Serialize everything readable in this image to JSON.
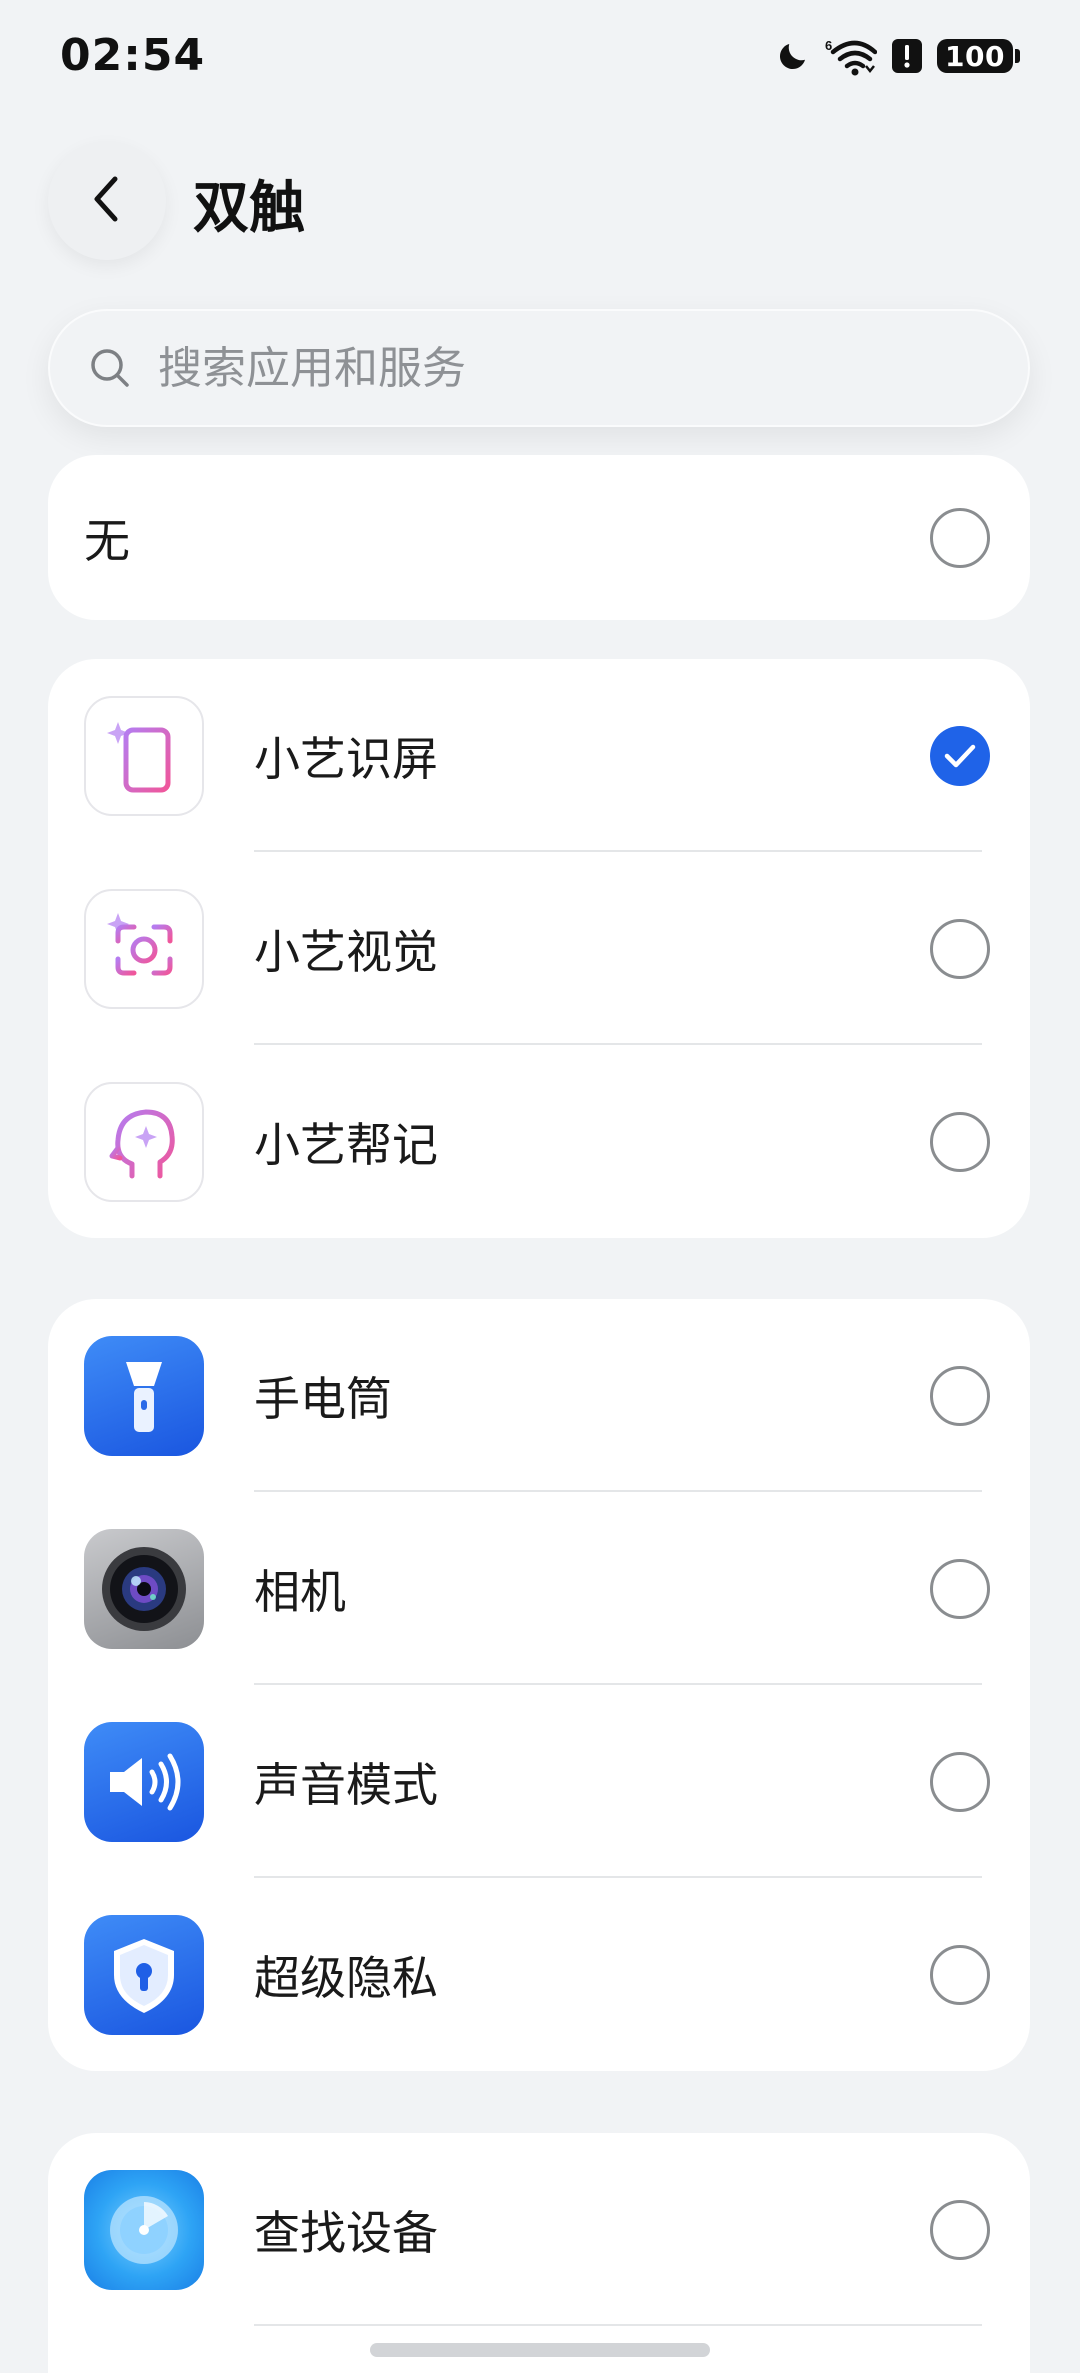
{
  "status_bar": {
    "time": "02:54",
    "icons": [
      "moon-icon",
      "wifi-icon",
      "alert-icon"
    ],
    "battery": "100"
  },
  "header": {
    "title": "双触",
    "back_icon": "chevron-left-icon"
  },
  "search": {
    "placeholder": "搜索应用和服务"
  },
  "options": {
    "none": {
      "label": "无",
      "selected": false
    },
    "assistant": [
      {
        "label": "小艺识屏",
        "icon": "screen-recognition-icon",
        "selected": true
      },
      {
        "label": "小艺视觉",
        "icon": "vision-icon",
        "selected": false
      },
      {
        "label": "小艺帮记",
        "icon": "memory-icon",
        "selected": false
      }
    ],
    "tools": [
      {
        "label": "手电筒",
        "icon": "flashlight-icon",
        "selected": false
      },
      {
        "label": "相机",
        "icon": "camera-icon",
        "selected": false
      },
      {
        "label": "声音模式",
        "icon": "sound-icon",
        "selected": false
      },
      {
        "label": "超级隐私",
        "icon": "privacy-shield-icon",
        "selected": false
      }
    ],
    "more": [
      {
        "label": "查找设备",
        "icon": "find-device-icon",
        "selected": false
      }
    ]
  },
  "colors": {
    "accent": "#1f63e8",
    "background": "#f1f3f5",
    "card": "#ffffff"
  }
}
